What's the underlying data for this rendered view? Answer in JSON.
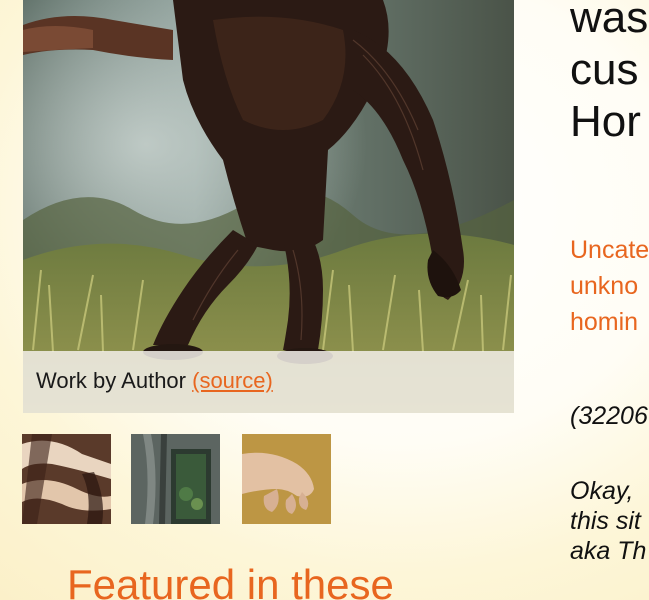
{
  "main_image": {
    "caption_label": "Work by Author",
    "source_link": "(source)"
  },
  "thumbnails": [
    {
      "icon": "painting-thumbnail-striped"
    },
    {
      "icon": "painting-thumbnail-window"
    },
    {
      "icon": "painting-thumbnail-hand"
    }
  ],
  "featured_heading": "Featured in these",
  "title_lines": [
    "was",
    "cus",
    "Hor"
  ],
  "category_lines": [
    "Uncate",
    "unkno",
    "homin"
  ],
  "id_text": "(32206",
  "description_lines": [
    "Okay,",
    "this sit",
    "aka Th"
  ],
  "colors": {
    "accent": "#e8661f",
    "text": "#111111",
    "background": "#fdf6d8"
  }
}
